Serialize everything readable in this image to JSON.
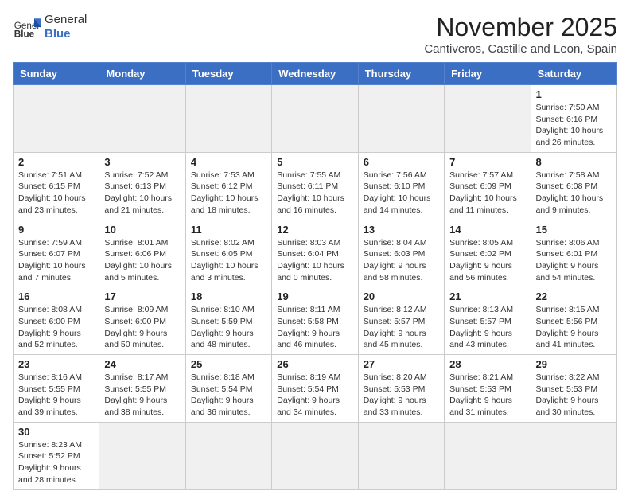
{
  "header": {
    "logo_text_normal": "General",
    "logo_text_bold": "Blue",
    "month_title": "November 2025",
    "location": "Cantiveros, Castille and Leon, Spain"
  },
  "weekdays": [
    "Sunday",
    "Monday",
    "Tuesday",
    "Wednesday",
    "Thursday",
    "Friday",
    "Saturday"
  ],
  "weeks": [
    [
      {
        "day": "",
        "info": ""
      },
      {
        "day": "",
        "info": ""
      },
      {
        "day": "",
        "info": ""
      },
      {
        "day": "",
        "info": ""
      },
      {
        "day": "",
        "info": ""
      },
      {
        "day": "",
        "info": ""
      },
      {
        "day": "1",
        "info": "Sunrise: 7:50 AM\nSunset: 6:16 PM\nDaylight: 10 hours\nand 26 minutes."
      }
    ],
    [
      {
        "day": "2",
        "info": "Sunrise: 7:51 AM\nSunset: 6:15 PM\nDaylight: 10 hours\nand 23 minutes."
      },
      {
        "day": "3",
        "info": "Sunrise: 7:52 AM\nSunset: 6:13 PM\nDaylight: 10 hours\nand 21 minutes."
      },
      {
        "day": "4",
        "info": "Sunrise: 7:53 AM\nSunset: 6:12 PM\nDaylight: 10 hours\nand 18 minutes."
      },
      {
        "day": "5",
        "info": "Sunrise: 7:55 AM\nSunset: 6:11 PM\nDaylight: 10 hours\nand 16 minutes."
      },
      {
        "day": "6",
        "info": "Sunrise: 7:56 AM\nSunset: 6:10 PM\nDaylight: 10 hours\nand 14 minutes."
      },
      {
        "day": "7",
        "info": "Sunrise: 7:57 AM\nSunset: 6:09 PM\nDaylight: 10 hours\nand 11 minutes."
      },
      {
        "day": "8",
        "info": "Sunrise: 7:58 AM\nSunset: 6:08 PM\nDaylight: 10 hours\nand 9 minutes."
      }
    ],
    [
      {
        "day": "9",
        "info": "Sunrise: 7:59 AM\nSunset: 6:07 PM\nDaylight: 10 hours\nand 7 minutes."
      },
      {
        "day": "10",
        "info": "Sunrise: 8:01 AM\nSunset: 6:06 PM\nDaylight: 10 hours\nand 5 minutes."
      },
      {
        "day": "11",
        "info": "Sunrise: 8:02 AM\nSunset: 6:05 PM\nDaylight: 10 hours\nand 3 minutes."
      },
      {
        "day": "12",
        "info": "Sunrise: 8:03 AM\nSunset: 6:04 PM\nDaylight: 10 hours\nand 0 minutes."
      },
      {
        "day": "13",
        "info": "Sunrise: 8:04 AM\nSunset: 6:03 PM\nDaylight: 9 hours\nand 58 minutes."
      },
      {
        "day": "14",
        "info": "Sunrise: 8:05 AM\nSunset: 6:02 PM\nDaylight: 9 hours\nand 56 minutes."
      },
      {
        "day": "15",
        "info": "Sunrise: 8:06 AM\nSunset: 6:01 PM\nDaylight: 9 hours\nand 54 minutes."
      }
    ],
    [
      {
        "day": "16",
        "info": "Sunrise: 8:08 AM\nSunset: 6:00 PM\nDaylight: 9 hours\nand 52 minutes."
      },
      {
        "day": "17",
        "info": "Sunrise: 8:09 AM\nSunset: 6:00 PM\nDaylight: 9 hours\nand 50 minutes."
      },
      {
        "day": "18",
        "info": "Sunrise: 8:10 AM\nSunset: 5:59 PM\nDaylight: 9 hours\nand 48 minutes."
      },
      {
        "day": "19",
        "info": "Sunrise: 8:11 AM\nSunset: 5:58 PM\nDaylight: 9 hours\nand 46 minutes."
      },
      {
        "day": "20",
        "info": "Sunrise: 8:12 AM\nSunset: 5:57 PM\nDaylight: 9 hours\nand 45 minutes."
      },
      {
        "day": "21",
        "info": "Sunrise: 8:13 AM\nSunset: 5:57 PM\nDaylight: 9 hours\nand 43 minutes."
      },
      {
        "day": "22",
        "info": "Sunrise: 8:15 AM\nSunset: 5:56 PM\nDaylight: 9 hours\nand 41 minutes."
      }
    ],
    [
      {
        "day": "23",
        "info": "Sunrise: 8:16 AM\nSunset: 5:55 PM\nDaylight: 9 hours\nand 39 minutes."
      },
      {
        "day": "24",
        "info": "Sunrise: 8:17 AM\nSunset: 5:55 PM\nDaylight: 9 hours\nand 38 minutes."
      },
      {
        "day": "25",
        "info": "Sunrise: 8:18 AM\nSunset: 5:54 PM\nDaylight: 9 hours\nand 36 minutes."
      },
      {
        "day": "26",
        "info": "Sunrise: 8:19 AM\nSunset: 5:54 PM\nDaylight: 9 hours\nand 34 minutes."
      },
      {
        "day": "27",
        "info": "Sunrise: 8:20 AM\nSunset: 5:53 PM\nDaylight: 9 hours\nand 33 minutes."
      },
      {
        "day": "28",
        "info": "Sunrise: 8:21 AM\nSunset: 5:53 PM\nDaylight: 9 hours\nand 31 minutes."
      },
      {
        "day": "29",
        "info": "Sunrise: 8:22 AM\nSunset: 5:53 PM\nDaylight: 9 hours\nand 30 minutes."
      }
    ],
    [
      {
        "day": "30",
        "info": "Sunrise: 8:23 AM\nSunset: 5:52 PM\nDaylight: 9 hours\nand 28 minutes."
      },
      {
        "day": "",
        "info": ""
      },
      {
        "day": "",
        "info": ""
      },
      {
        "day": "",
        "info": ""
      },
      {
        "day": "",
        "info": ""
      },
      {
        "day": "",
        "info": ""
      },
      {
        "day": "",
        "info": ""
      }
    ]
  ]
}
